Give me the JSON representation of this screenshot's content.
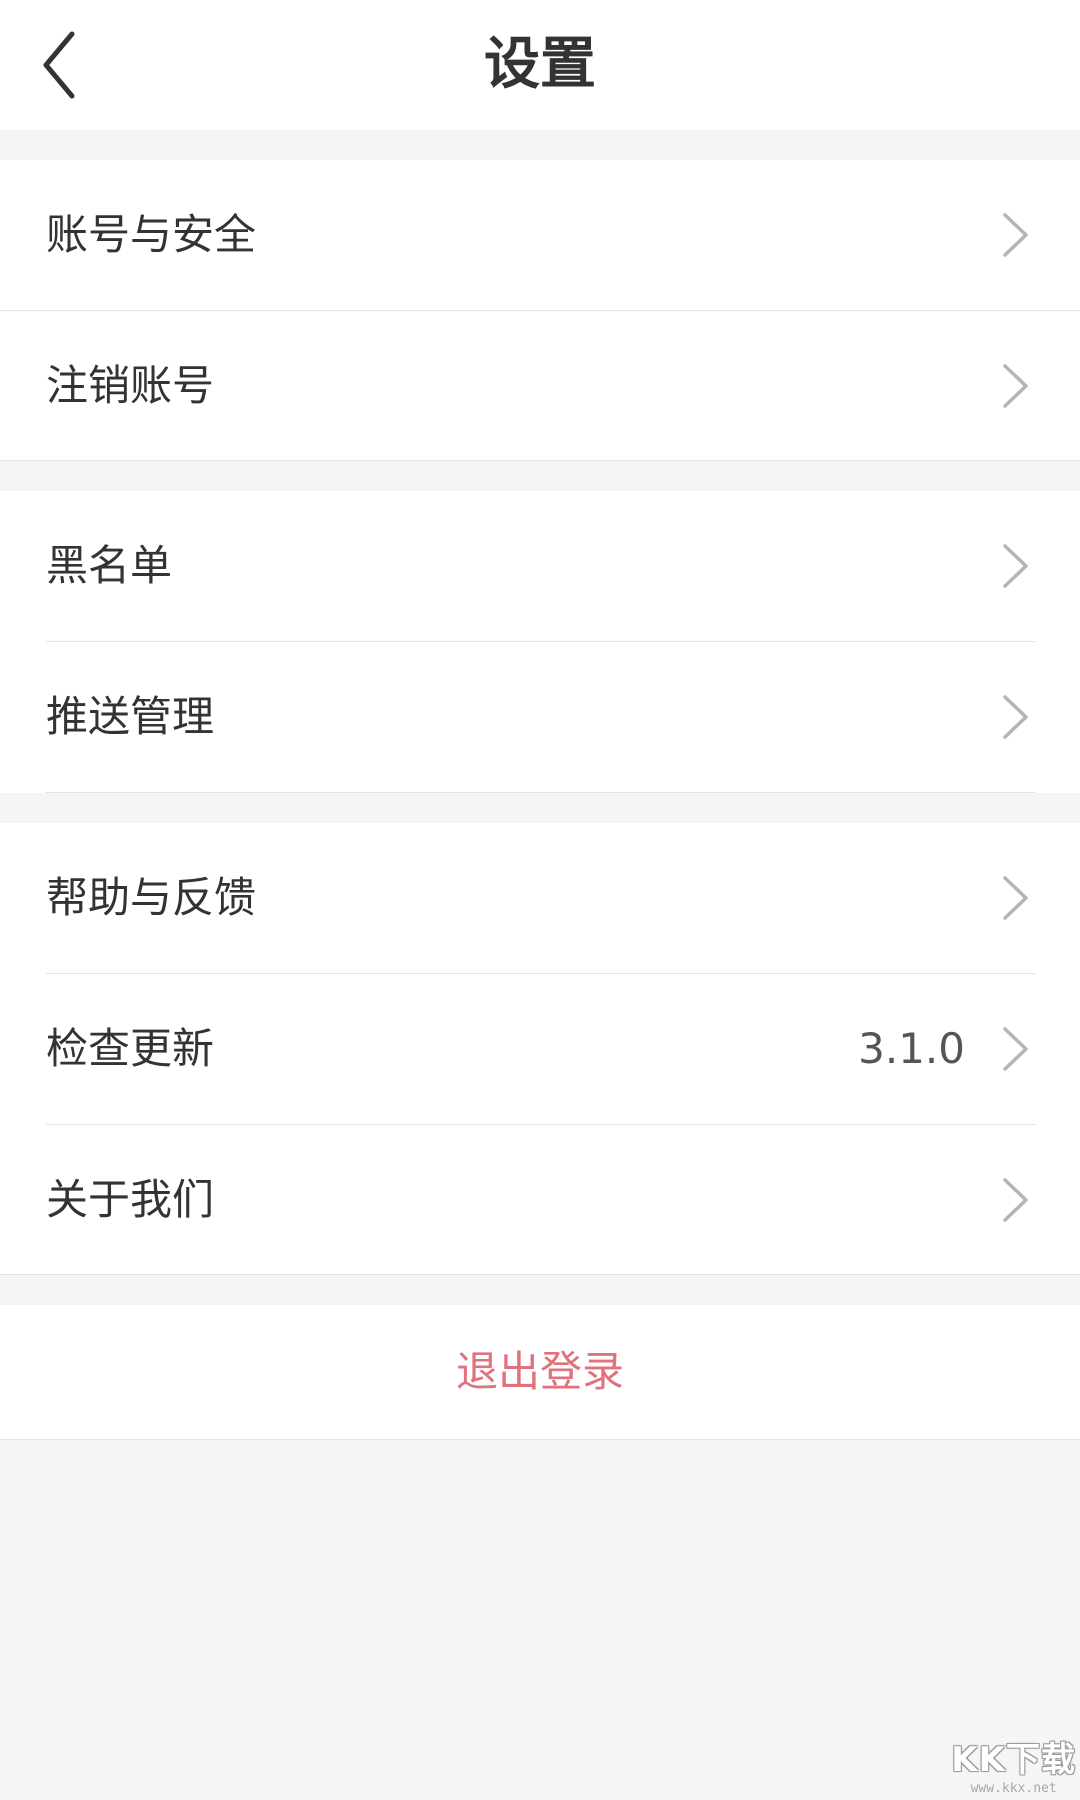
{
  "header": {
    "title": "设置",
    "back_icon": "chevron-left-icon"
  },
  "groups": [
    {
      "items": [
        {
          "label": "账号与安全",
          "icon": "chevron-right-icon"
        },
        {
          "label": "注销账号",
          "icon": "chevron-right-icon"
        }
      ]
    },
    {
      "items": [
        {
          "label": "黑名单",
          "icon": "chevron-right-icon"
        },
        {
          "label": "推送管理",
          "icon": "chevron-right-icon"
        }
      ]
    },
    {
      "items": [
        {
          "label": "帮助与反馈",
          "icon": "chevron-right-icon"
        },
        {
          "label": "检查更新",
          "value": "3.1.0",
          "icon": "chevron-right-icon"
        },
        {
          "label": "关于我们",
          "icon": "chevron-right-icon"
        }
      ]
    }
  ],
  "logout": {
    "label": "退出登录",
    "color": "#e0727c"
  },
  "colors": {
    "page_background": "#f5f5f5",
    "card_background": "#ffffff",
    "text_primary": "#333333",
    "chevron": "#b5b5b5",
    "divider": "#e3e3e3"
  },
  "watermark": {
    "brand": "KK下载",
    "url": "www.kkx.net"
  }
}
